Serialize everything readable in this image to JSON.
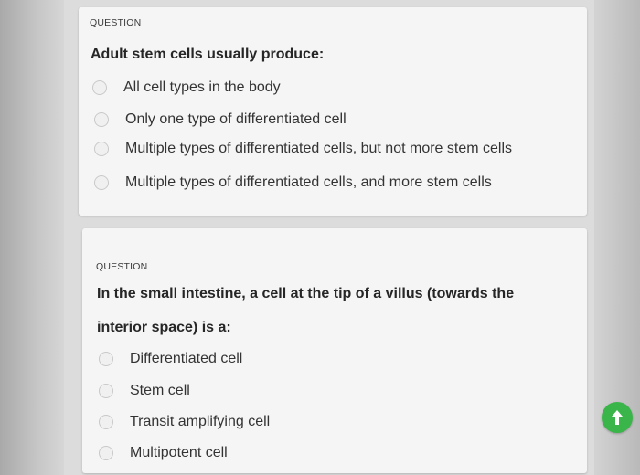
{
  "questions": [
    {
      "tag": "QUESTION",
      "prompt": "Adult stem cells usually produce:",
      "options": [
        "All cell types in the body",
        "Only one type of differentiated cell",
        "Multiple types of differentiated cells, but not more stem cells",
        "Multiple types of differentiated cells, and more stem cells"
      ]
    },
    {
      "tag": "QUESTION",
      "prompt_line1": "In the small intestine, a cell at the tip of a villus (towards the",
      "prompt_line2": "interior space) is a:",
      "options": [
        "Differentiated cell",
        "Stem cell",
        "Transit amplifying cell",
        "Multipotent cell"
      ]
    }
  ],
  "scroll_top_button": {
    "icon": "arrow-up-icon",
    "color": "#3ab54a"
  }
}
